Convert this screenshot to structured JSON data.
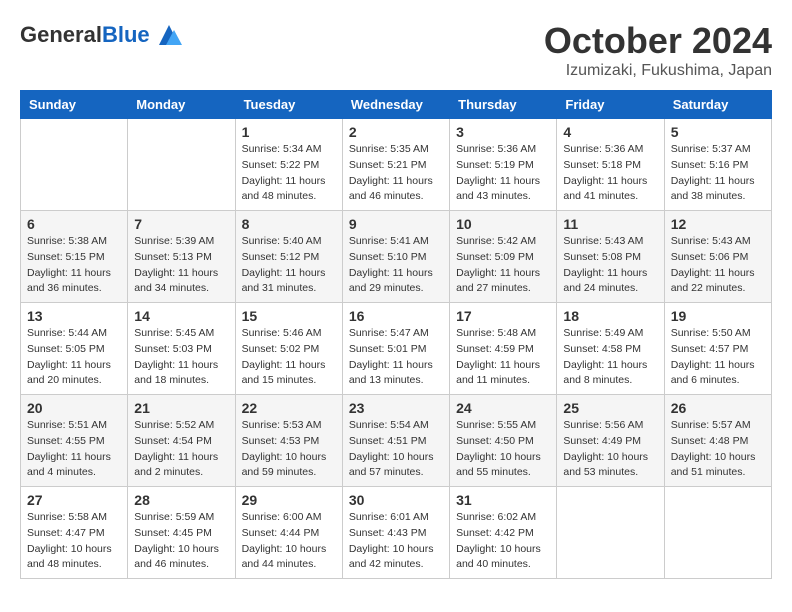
{
  "header": {
    "logo_general": "General",
    "logo_blue": "Blue",
    "month_title": "October 2024",
    "location": "Izumizaki, Fukushima, Japan"
  },
  "days_of_week": [
    "Sunday",
    "Monday",
    "Tuesday",
    "Wednesday",
    "Thursday",
    "Friday",
    "Saturday"
  ],
  "weeks": [
    [
      {
        "day": "",
        "info": ""
      },
      {
        "day": "",
        "info": ""
      },
      {
        "day": "1",
        "info": "Sunrise: 5:34 AM\nSunset: 5:22 PM\nDaylight: 11 hours and 48 minutes."
      },
      {
        "day": "2",
        "info": "Sunrise: 5:35 AM\nSunset: 5:21 PM\nDaylight: 11 hours and 46 minutes."
      },
      {
        "day": "3",
        "info": "Sunrise: 5:36 AM\nSunset: 5:19 PM\nDaylight: 11 hours and 43 minutes."
      },
      {
        "day": "4",
        "info": "Sunrise: 5:36 AM\nSunset: 5:18 PM\nDaylight: 11 hours and 41 minutes."
      },
      {
        "day": "5",
        "info": "Sunrise: 5:37 AM\nSunset: 5:16 PM\nDaylight: 11 hours and 38 minutes."
      }
    ],
    [
      {
        "day": "6",
        "info": "Sunrise: 5:38 AM\nSunset: 5:15 PM\nDaylight: 11 hours and 36 minutes."
      },
      {
        "day": "7",
        "info": "Sunrise: 5:39 AM\nSunset: 5:13 PM\nDaylight: 11 hours and 34 minutes."
      },
      {
        "day": "8",
        "info": "Sunrise: 5:40 AM\nSunset: 5:12 PM\nDaylight: 11 hours and 31 minutes."
      },
      {
        "day": "9",
        "info": "Sunrise: 5:41 AM\nSunset: 5:10 PM\nDaylight: 11 hours and 29 minutes."
      },
      {
        "day": "10",
        "info": "Sunrise: 5:42 AM\nSunset: 5:09 PM\nDaylight: 11 hours and 27 minutes."
      },
      {
        "day": "11",
        "info": "Sunrise: 5:43 AM\nSunset: 5:08 PM\nDaylight: 11 hours and 24 minutes."
      },
      {
        "day": "12",
        "info": "Sunrise: 5:43 AM\nSunset: 5:06 PM\nDaylight: 11 hours and 22 minutes."
      }
    ],
    [
      {
        "day": "13",
        "info": "Sunrise: 5:44 AM\nSunset: 5:05 PM\nDaylight: 11 hours and 20 minutes."
      },
      {
        "day": "14",
        "info": "Sunrise: 5:45 AM\nSunset: 5:03 PM\nDaylight: 11 hours and 18 minutes."
      },
      {
        "day": "15",
        "info": "Sunrise: 5:46 AM\nSunset: 5:02 PM\nDaylight: 11 hours and 15 minutes."
      },
      {
        "day": "16",
        "info": "Sunrise: 5:47 AM\nSunset: 5:01 PM\nDaylight: 11 hours and 13 minutes."
      },
      {
        "day": "17",
        "info": "Sunrise: 5:48 AM\nSunset: 4:59 PM\nDaylight: 11 hours and 11 minutes."
      },
      {
        "day": "18",
        "info": "Sunrise: 5:49 AM\nSunset: 4:58 PM\nDaylight: 11 hours and 8 minutes."
      },
      {
        "day": "19",
        "info": "Sunrise: 5:50 AM\nSunset: 4:57 PM\nDaylight: 11 hours and 6 minutes."
      }
    ],
    [
      {
        "day": "20",
        "info": "Sunrise: 5:51 AM\nSunset: 4:55 PM\nDaylight: 11 hours and 4 minutes."
      },
      {
        "day": "21",
        "info": "Sunrise: 5:52 AM\nSunset: 4:54 PM\nDaylight: 11 hours and 2 minutes."
      },
      {
        "day": "22",
        "info": "Sunrise: 5:53 AM\nSunset: 4:53 PM\nDaylight: 10 hours and 59 minutes."
      },
      {
        "day": "23",
        "info": "Sunrise: 5:54 AM\nSunset: 4:51 PM\nDaylight: 10 hours and 57 minutes."
      },
      {
        "day": "24",
        "info": "Sunrise: 5:55 AM\nSunset: 4:50 PM\nDaylight: 10 hours and 55 minutes."
      },
      {
        "day": "25",
        "info": "Sunrise: 5:56 AM\nSunset: 4:49 PM\nDaylight: 10 hours and 53 minutes."
      },
      {
        "day": "26",
        "info": "Sunrise: 5:57 AM\nSunset: 4:48 PM\nDaylight: 10 hours and 51 minutes."
      }
    ],
    [
      {
        "day": "27",
        "info": "Sunrise: 5:58 AM\nSunset: 4:47 PM\nDaylight: 10 hours and 48 minutes."
      },
      {
        "day": "28",
        "info": "Sunrise: 5:59 AM\nSunset: 4:45 PM\nDaylight: 10 hours and 46 minutes."
      },
      {
        "day": "29",
        "info": "Sunrise: 6:00 AM\nSunset: 4:44 PM\nDaylight: 10 hours and 44 minutes."
      },
      {
        "day": "30",
        "info": "Sunrise: 6:01 AM\nSunset: 4:43 PM\nDaylight: 10 hours and 42 minutes."
      },
      {
        "day": "31",
        "info": "Sunrise: 6:02 AM\nSunset: 4:42 PM\nDaylight: 10 hours and 40 minutes."
      },
      {
        "day": "",
        "info": ""
      },
      {
        "day": "",
        "info": ""
      }
    ]
  ]
}
